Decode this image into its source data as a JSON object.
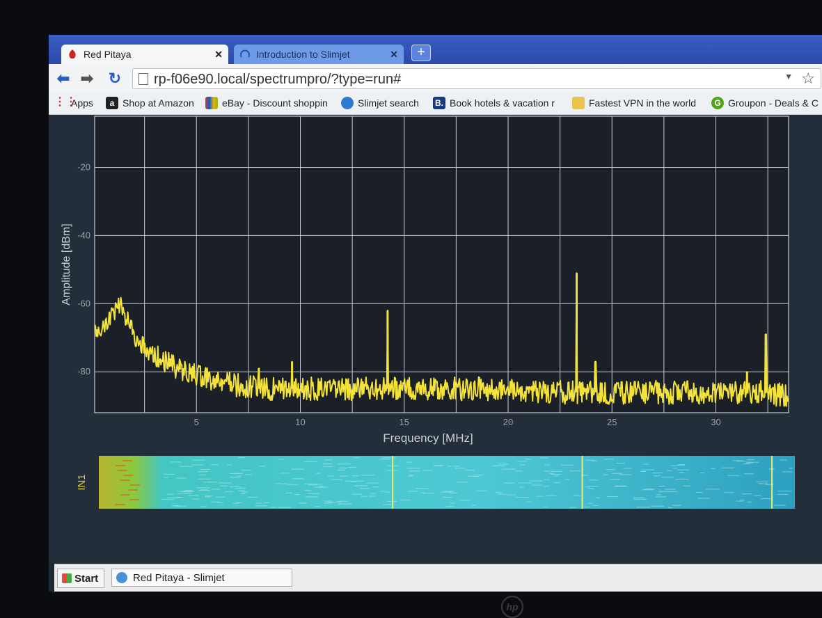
{
  "browser": {
    "tabs": [
      {
        "label": "Red Pitaya",
        "active": true
      },
      {
        "label": "Introduction to Slimjet",
        "active": false
      }
    ],
    "address": "rp-f06e90.local/spectrumpro/?type=run#",
    "bookmarks": [
      {
        "label": "Apps",
        "icon": "apps-grid-icon"
      },
      {
        "label": "Shop at Amazon",
        "icon": "amazon-icon"
      },
      {
        "label": "eBay - Discount shoppin",
        "icon": "ebay-bag-icon"
      },
      {
        "label": "Slimjet search",
        "icon": "globe-icon"
      },
      {
        "label": "Book hotels & vacation r",
        "icon": "booking-icon"
      },
      {
        "label": "Fastest VPN in the world",
        "icon": "vpn-icon"
      },
      {
        "label": "Groupon - Deals & C",
        "icon": "groupon-icon"
      }
    ]
  },
  "taskbar": {
    "start_label": "Start",
    "window_label": "Red Pitaya - Slimjet"
  },
  "colors": {
    "trace": "#f2e23a",
    "plot_bg": "#1b2028",
    "grid": "#c7ccd6",
    "axis_text": "#9aa3ad",
    "waterfall_label": "#d8c94a"
  },
  "chart_data": {
    "type": "line",
    "xlabel": "Frequency [MHz]",
    "ylabel": "Amplitude [dBm]",
    "xlim": [
      0.1,
      33.5
    ],
    "ylim": [
      -92,
      -5
    ],
    "x_ticks": [
      5,
      10,
      15,
      20,
      25,
      30
    ],
    "y_ticks": [
      -20,
      -40,
      -60,
      -80
    ],
    "grid": true,
    "noise_floor_dbm": -85,
    "series": [
      {
        "x": [
          0.1,
          0.5,
          1.0,
          1.2,
          1.5,
          1.8,
          2.0,
          2.5,
          3.0,
          3.5,
          4.0,
          4.5,
          5.0,
          6.0,
          7.0,
          8.0,
          9.0,
          10.0,
          12.0,
          14.0,
          16.0,
          18.0,
          20.0,
          22.0,
          24.0,
          26.0,
          28.0,
          30.0,
          32.0,
          33.5
        ],
        "y": [
          -68,
          -66,
          -64,
          -59,
          -62,
          -65,
          -70,
          -73,
          -75,
          -77,
          -79,
          -80,
          -81,
          -83,
          -84,
          -85,
          -85,
          -85,
          -85,
          -85,
          -85,
          -85,
          -85,
          -86,
          -86,
          -86,
          -86,
          -86,
          -86,
          -87
        ]
      }
    ],
    "peaks": [
      {
        "x": 4.2,
        "y": -77
      },
      {
        "x": 8.0,
        "y": -79
      },
      {
        "x": 9.6,
        "y": -77
      },
      {
        "x": 14.2,
        "y": -62
      },
      {
        "x": 23.3,
        "y": -51
      },
      {
        "x": 24.2,
        "y": -77
      },
      {
        "x": 31.5,
        "y": -80
      },
      {
        "x": 32.4,
        "y": -69
      }
    ],
    "waterfall": {
      "channel_label": "IN1",
      "bright_lines_mhz": [
        14.2,
        23.3,
        32.4
      ]
    }
  }
}
